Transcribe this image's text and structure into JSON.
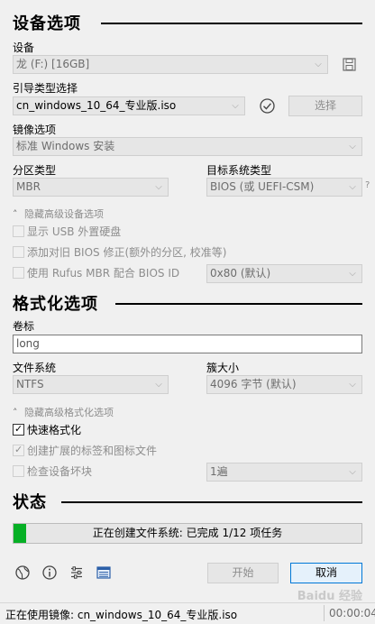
{
  "sections": {
    "device_options": "设备选项",
    "format_options": "格式化选项",
    "status": "状态"
  },
  "device": {
    "label": "设备",
    "value": "龙 (F:) [16GB]"
  },
  "boot": {
    "label": "引导类型选择",
    "value": "cn_windows_10_64_专业版.iso",
    "select_button": "选择"
  },
  "image": {
    "label": "镜像选项",
    "value": "标准 Windows 安装"
  },
  "partition": {
    "label": "分区类型",
    "value": "MBR"
  },
  "target": {
    "label": "目标系统类型",
    "value": "BIOS (或 UEFI-CSM)",
    "help": "?"
  },
  "advanced_device": {
    "toggle_label": "隐藏高级设备选项",
    "show_usb": "显示 USB 外置硬盘",
    "add_fix": "添加对旧 BIOS 修正(额外的分区, 校准等)",
    "use_rufus_mbr": "使用 Rufus MBR 配合 BIOS ID",
    "bios_id_value": "0x80 (默认)"
  },
  "volume": {
    "label": "卷标",
    "value": "long"
  },
  "filesystem": {
    "label": "文件系统",
    "value": "NTFS"
  },
  "cluster": {
    "label": "簇大小",
    "value": "4096 字节 (默认)"
  },
  "advanced_format": {
    "toggle_label": "隐藏高级格式化选项",
    "quick_format": "快速格式化",
    "extended_label": "创建扩展的标签和图标文件",
    "check_bad": "检查设备坏块",
    "passes_value": "1遍"
  },
  "progress": {
    "text": "正在创建文件系统: 已完成 1/12 项任务",
    "fraction": 0.035
  },
  "buttons": {
    "start": "开始",
    "cancel": "取消"
  },
  "status_bar": {
    "text": "正在使用镜像: cn_windows_10_64_专业版.iso",
    "time": "00:00:04"
  },
  "watermark": "Baidu 经验",
  "icons": [
    "globe-icon",
    "info-icon",
    "settings-sliders-icon",
    "log-icon",
    "save-icon",
    "check-circle-icon"
  ],
  "colors": {
    "progress": "#06b025",
    "accent": "#0078d7"
  }
}
